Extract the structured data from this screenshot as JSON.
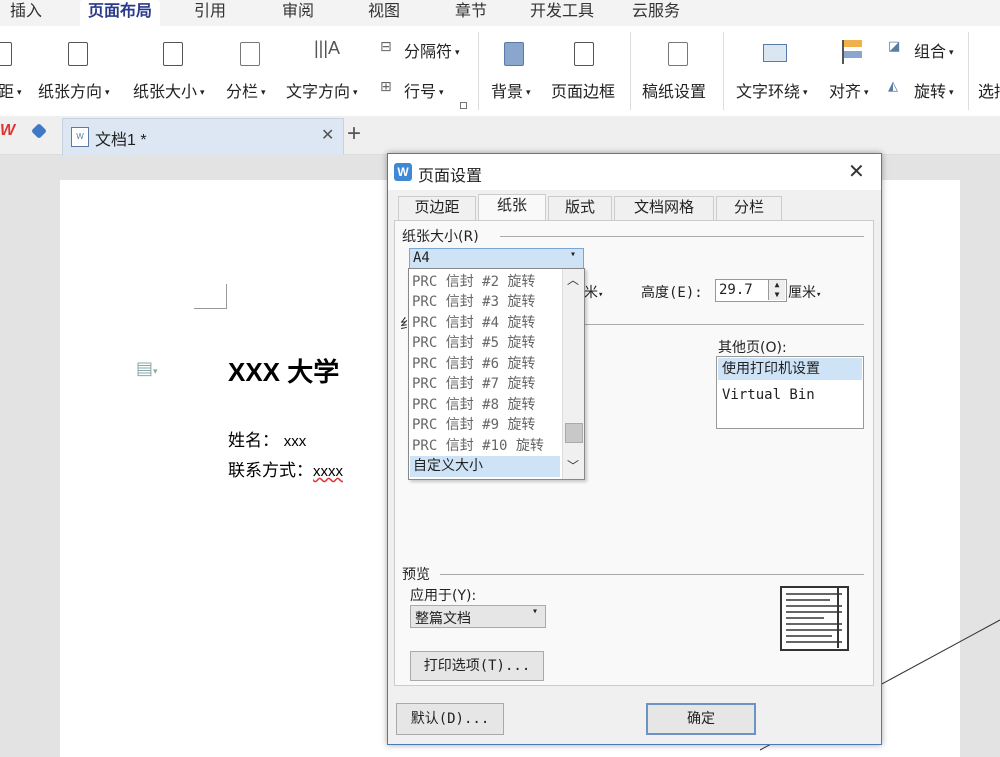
{
  "menu": {
    "tabs": [
      {
        "label": "插入"
      },
      {
        "label": "页面布局"
      },
      {
        "label": "引用"
      },
      {
        "label": "审阅"
      },
      {
        "label": "视图"
      },
      {
        "label": "章节"
      },
      {
        "label": "开发工具"
      },
      {
        "label": "云服务"
      }
    ]
  },
  "ribbon": {
    "margins": "距",
    "orientation": "纸张方向",
    "size": "纸张大小",
    "columns": "分栏",
    "text_direction": "文字方向",
    "break": "分隔符",
    "line_number": "行号",
    "background": "背景",
    "page_border": "页面边框",
    "manuscript": "稿纸设置",
    "wrap": "文字环绕",
    "align": "对齐",
    "group": "组合",
    "rotate": "旋转",
    "select": "选持"
  },
  "doc_tab": {
    "name": "文档1 *"
  },
  "document": {
    "title": "XXX 大学",
    "name_label": "姓名：",
    "name_value": "xxx",
    "contact_label": "联系方式：",
    "contact_value": "xxxx"
  },
  "dialog": {
    "title": "页面设置",
    "tabs": [
      {
        "label": "页边距"
      },
      {
        "label": "纸张"
      },
      {
        "label": "版式"
      },
      {
        "label": "文档网格"
      },
      {
        "label": "分栏"
      }
    ],
    "paper_size_label": "纸张大小(R)",
    "paper_size_value": "A4",
    "dropdown_items": [
      "PRC 信封 #2 旋转",
      "PRC 信封 #3 旋转",
      "PRC 信封 #4 旋转",
      "PRC 信封 #5 旋转",
      "PRC 信封 #6 旋转",
      "PRC 信封 #7 旋转",
      "PRC 信封 #8 旋转",
      "PRC 信封 #9 旋转",
      "PRC 信封 #10 旋转",
      "自定义大小"
    ],
    "width_unit_partial": "米",
    "height_label": "高度(E):",
    "height_value": "29.7",
    "height_unit": "厘米",
    "source_partial": "纟",
    "other_pages_label": "其他页(O):",
    "other_pages_items": [
      "使用打印机设置",
      "Virtual Bin"
    ],
    "preview_label": "预览",
    "apply_label": "应用于(Y):",
    "apply_value": "整篇文档",
    "print_options": "打印选项(T)...",
    "default_button": "默认(D)...",
    "ok_button": "确定"
  }
}
